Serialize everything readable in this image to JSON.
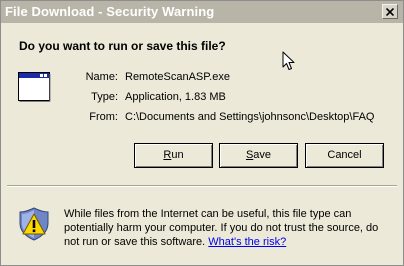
{
  "window": {
    "title": "File Download - Security Warning",
    "close_glyph": "×"
  },
  "dialog": {
    "question": "Do you want to run or save this file?",
    "file_icon": "application-window-icon",
    "info": {
      "name_label": "Name:",
      "name_value": "RemoteScanASP.exe",
      "type_label": "Type:",
      "type_value": "Application, 1.83 MB",
      "from_label": "From:",
      "from_value": "C:\\Documents and Settings\\johnsonc\\Desktop\\FAQ"
    },
    "buttons": {
      "run_rest": "un",
      "run_mnemonic": "R",
      "save_rest": "ave",
      "save_mnemonic": "S",
      "cancel": "Cancel"
    },
    "warning": {
      "icon": "security-shield-warning-icon",
      "text": "While files from the Internet can be useful, this file type can potentially harm your computer. If you do not trust the source, do not run or save this software. ",
      "link": "What's the risk?"
    }
  }
}
